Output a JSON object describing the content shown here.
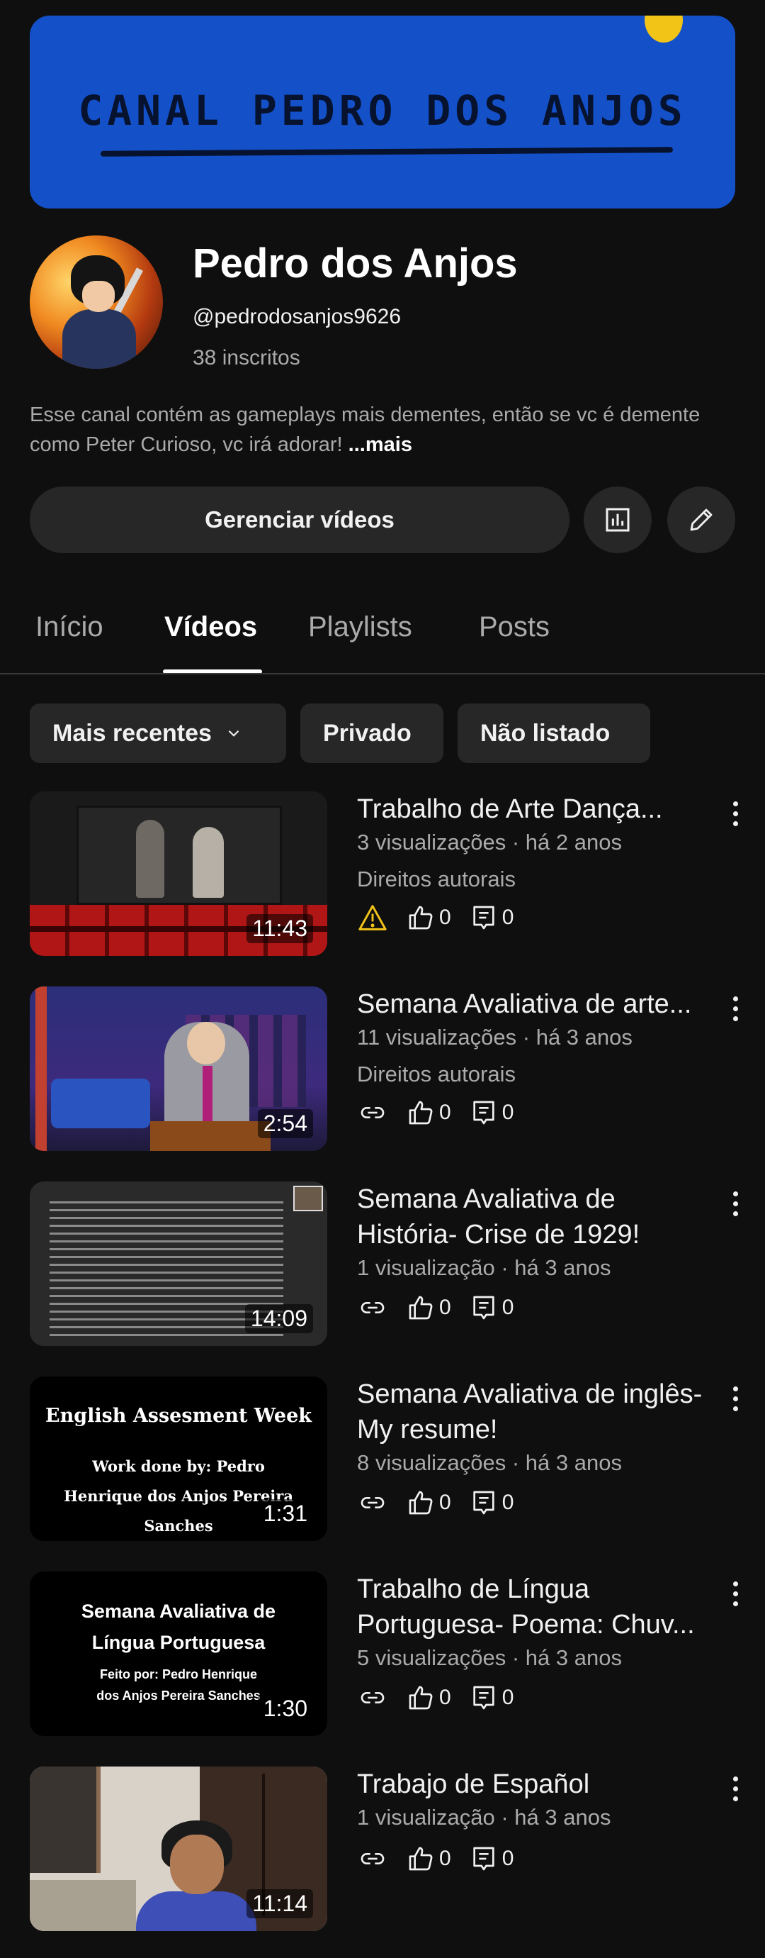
{
  "banner": {
    "title": "CANAL PEDRO DOS ANJOS",
    "bg_color": "#1450c8"
  },
  "channel": {
    "name": "Pedro dos Anjos",
    "handle": "@pedrodosanjos9626",
    "subscribers": "38 inscritos",
    "description": "Esse canal contém as gameplays mais dementes, então se vc é demente como Peter Curioso, vc irá adorar! ",
    "more_label": "...mais"
  },
  "actions": {
    "manage_label": "Gerenciar vídeos",
    "analytics_icon": "analytics-icon",
    "edit_icon": "pencil-icon"
  },
  "tabs": [
    {
      "label": "Início",
      "active": false
    },
    {
      "label": "Vídeos",
      "active": true
    },
    {
      "label": "Playlists",
      "active": false
    },
    {
      "label": "Posts",
      "active": false
    }
  ],
  "filters": {
    "sort_label": "Mais recentes",
    "private_label": "Privado",
    "unlisted_label": "Não listado"
  },
  "videos": [
    {
      "title": "Trabalho de Arte  Dança...",
      "meta": "3 visualizações · há 2 anos",
      "restriction": "Direitos autorais",
      "duration": "11:43",
      "likes": "0",
      "comments": "0",
      "status_icon": "warning-icon"
    },
    {
      "title": "Semana Avaliativa de arte...",
      "meta": "11 visualizações · há 3 anos",
      "restriction": "Direitos autorais",
      "duration": "2:54",
      "likes": "0",
      "comments": "0",
      "status_icon": "link-icon"
    },
    {
      "title": "Semana Avaliativa de História- Crise de 1929!",
      "meta": "1 visualização · há 3 anos",
      "duration": "14:09",
      "likes": "0",
      "comments": "0",
      "status_icon": "link-icon"
    },
    {
      "title": "Semana Avaliativa de inglês- My resume!",
      "meta": "8 visualizações · há 3 anos",
      "duration": "1:31",
      "likes": "0",
      "comments": "0",
      "status_icon": "link-icon",
      "thumb_text_1": "English Assesment Week",
      "thumb_text_2": "Work done by: Pedro Henrique dos Anjos Pereira Sanches"
    },
    {
      "title": "Trabalho de Língua Portuguesa- Poema: Chuv...",
      "meta": "5 visualizações · há 3 anos",
      "duration": "1:30",
      "likes": "0",
      "comments": "0",
      "status_icon": "link-icon",
      "thumb_text_1": "Semana Avaliativa de Língua Portuguesa",
      "thumb_text_2": "Feito por: Pedro Henrique dos Anjos Pereira Sanches"
    },
    {
      "title": "Trabajo de Español",
      "meta": "1 visualização · há 3 anos",
      "duration": "11:14",
      "likes": "0",
      "comments": "0",
      "status_icon": "link-icon"
    }
  ],
  "colors": {
    "background": "#0f0f0f",
    "surface": "#272727",
    "warning": "#f2c418"
  }
}
